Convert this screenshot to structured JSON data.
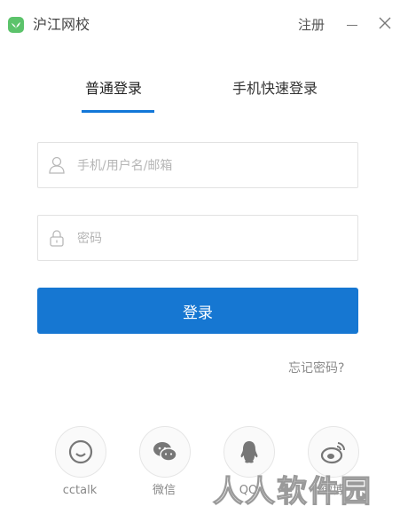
{
  "titlebar": {
    "app_name": "沪江网校",
    "register_label": "注册",
    "minimize_icon": "minimize-icon",
    "close_icon": "close-icon",
    "logo_color": "#5cc36b"
  },
  "tabs": [
    {
      "label": "普通登录",
      "active": true
    },
    {
      "label": "手机快速登录",
      "active": false
    }
  ],
  "form": {
    "username": {
      "value": "",
      "placeholder": "手机/用户名/邮箱",
      "icon": "user-icon"
    },
    "password": {
      "value": "",
      "placeholder": "密码",
      "icon": "lock-icon"
    },
    "login_label": "登录",
    "forgot_label": "忘记密码?"
  },
  "social": [
    {
      "label": "cctalk",
      "icon": "cctalk-icon"
    },
    {
      "label": "微信",
      "icon": "wechat-icon"
    },
    {
      "label": "QQ",
      "icon": "qq-icon"
    },
    {
      "label": "微博",
      "icon": "weibo-icon"
    }
  ],
  "watermark": {
    "text": "人人软件园"
  },
  "colors": {
    "accent": "#1677d2",
    "tab_underline": "#1277d8"
  }
}
